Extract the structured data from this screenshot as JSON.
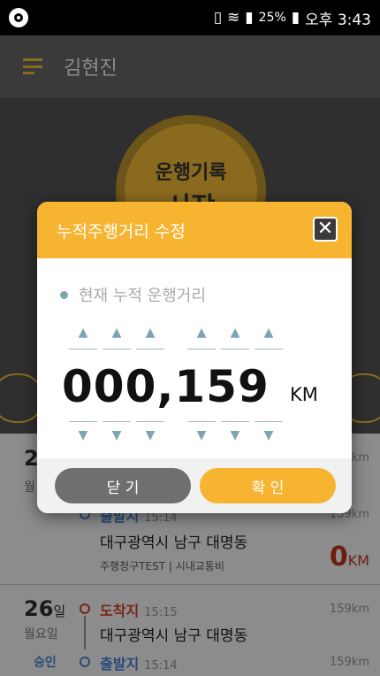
{
  "status_bar": {
    "battery": "25%",
    "time": "오후 3:43"
  },
  "header": {
    "user_name": "김현진"
  },
  "hero": {
    "button_line1": "운행기록",
    "button_line2": "시작"
  },
  "list": {
    "entry1": {
      "day": "2",
      "weekday": "월",
      "arrival_km": "159km",
      "departure_label": "출발지",
      "departure_time": "15:14",
      "departure_km": "159km",
      "address": "대구광역시 남구 대명동",
      "sub": "주행청구TEST | 시내교통비",
      "distance_value": "0",
      "distance_unit": "KM"
    },
    "entry2": {
      "day": "26",
      "day_unit": "일",
      "weekday": "월요일",
      "status": "승인",
      "arrival_label": "도착지",
      "arrival_time": "15:15",
      "arrival_km": "159km",
      "address": "대구광역시 남구 대명동",
      "departure_label": "출발지",
      "departure_time": "15:14",
      "departure_km": "159km"
    }
  },
  "modal": {
    "title": "누적주행거리 수정",
    "current_label": "현재 누적 운행거리",
    "value": "000,159",
    "unit": "KM",
    "close_button": "닫 기",
    "ok_button": "확 인"
  },
  "colors": {
    "accent": "#f6b431",
    "close_button": "#6f6f6f",
    "arrow": "#7fa3b3"
  }
}
